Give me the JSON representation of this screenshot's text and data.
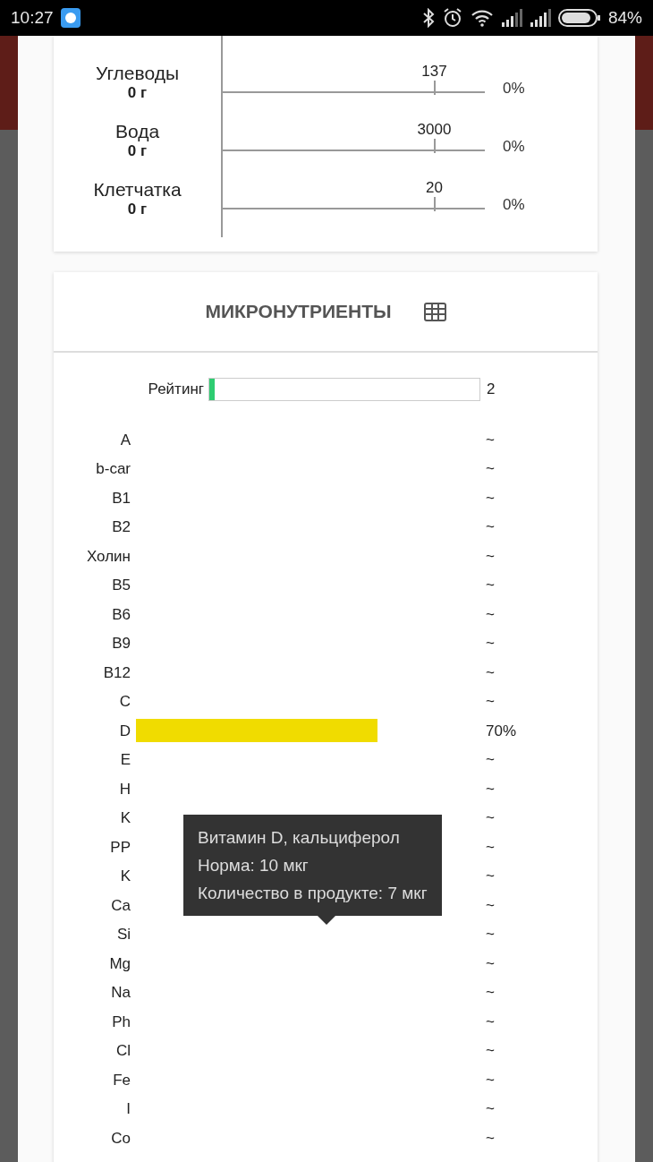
{
  "status_bar": {
    "time": "10:27",
    "battery": "84%"
  },
  "macros": [
    {
      "name": "Углеводы",
      "amount": "0 г",
      "norm": "137",
      "percent": "0%"
    },
    {
      "name": "Вода",
      "amount": "0 г",
      "norm": "3000",
      "percent": "0%"
    },
    {
      "name": "Клетчатка",
      "amount": "0 г",
      "norm": "20",
      "percent": "0%"
    }
  ],
  "micro": {
    "title": "МИКРОНУТРИЕНТЫ",
    "rating": {
      "label": "Рейтинг",
      "level": 0.02,
      "value": "2"
    },
    "nutrients": [
      {
        "name": "A",
        "value": "~"
      },
      {
        "name": "b-car",
        "value": "~"
      },
      {
        "name": "B1",
        "value": "~"
      },
      {
        "name": "B2",
        "value": "~"
      },
      {
        "name": "Холин",
        "value": "~"
      },
      {
        "name": "B5",
        "value": "~"
      },
      {
        "name": "B6",
        "value": "~"
      },
      {
        "name": "B9",
        "value": "~"
      },
      {
        "name": "B12",
        "value": "~"
      },
      {
        "name": "C",
        "value": "~"
      },
      {
        "name": "D",
        "level": 0.7,
        "value": "70%"
      },
      {
        "name": "E",
        "value": "~"
      },
      {
        "name": "H",
        "value": "~"
      },
      {
        "name": "K",
        "value": "~"
      },
      {
        "name": "PP",
        "value": "~"
      },
      {
        "name": "K",
        "value": "~"
      },
      {
        "name": "Ca",
        "value": "~"
      },
      {
        "name": "Si",
        "value": "~"
      },
      {
        "name": "Mg",
        "value": "~"
      },
      {
        "name": "Na",
        "value": "~"
      },
      {
        "name": "Ph",
        "value": "~"
      },
      {
        "name": "Cl",
        "value": "~"
      },
      {
        "name": "Fe",
        "value": "~"
      },
      {
        "name": "I",
        "value": "~"
      },
      {
        "name": "Co",
        "value": "~"
      }
    ]
  },
  "tooltip": {
    "lines": [
      "Витамин D, кальциферол",
      "Норма: 10 мкг",
      "Количество в продукте: 7 мкг"
    ]
  }
}
